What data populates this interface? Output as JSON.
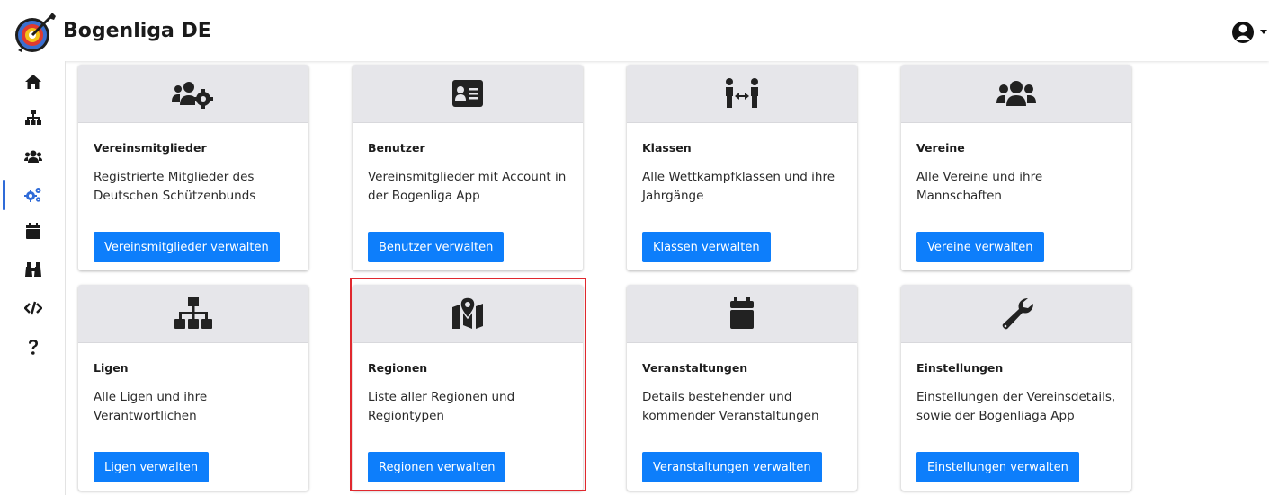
{
  "header": {
    "brand": "Bogenliga DE"
  },
  "sidebar": {
    "items": [
      {
        "icon": "home-icon"
      },
      {
        "icon": "sitemap-icon"
      },
      {
        "icon": "users-icon"
      },
      {
        "icon": "cogs-icon",
        "active": true
      },
      {
        "icon": "calendar-icon"
      },
      {
        "icon": "binoculars-icon"
      },
      {
        "icon": "code-icon"
      },
      {
        "icon": "question-icon"
      }
    ]
  },
  "cards": [
    {
      "icon": "users-cog-icon",
      "title": "Vereinsmitglieder",
      "text": "Registrierte Mitglieder des Deutschen Schützenbunds",
      "button": "Vereinsmitglieder verwalten"
    },
    {
      "icon": "id-card-icon",
      "title": "Benutzer",
      "text": "Vereinsmitglieder mit Account in der Bogenliga App",
      "button": "Benutzer verwalten"
    },
    {
      "icon": "people-arrows-icon",
      "title": "Klassen",
      "text": "Alle Wettkampfklassen und ihre Jahrgänge",
      "button": "Klassen verwalten"
    },
    {
      "icon": "users-icon",
      "title": "Vereine",
      "text": "Alle Vereine und ihre Mannschaften",
      "button": "Vereine verwalten"
    },
    {
      "icon": "sitemap-icon",
      "title": "Ligen",
      "text": "Alle Ligen und ihre Verantwortlichen",
      "button": "Ligen verwalten"
    },
    {
      "icon": "map-marked-icon",
      "title": "Regionen",
      "text": "Liste aller Regionen und Regiontypen",
      "button": "Regionen verwalten",
      "highlighted": true
    },
    {
      "icon": "calendar-icon",
      "title": "Veranstaltungen",
      "text": "Details bestehender und kommender Veranstaltungen",
      "button": "Veranstaltungen verwalten"
    },
    {
      "icon": "wrench-icon",
      "title": "Einstellungen",
      "text": "Einstellungen der Vereinsdetails, sowie der Bogenliaga App",
      "button": "Einstellungen verwalten"
    }
  ],
  "colors": {
    "accent": "#0d7efb",
    "highlight": "#e0282e",
    "card_header": "#e6e6ea"
  }
}
